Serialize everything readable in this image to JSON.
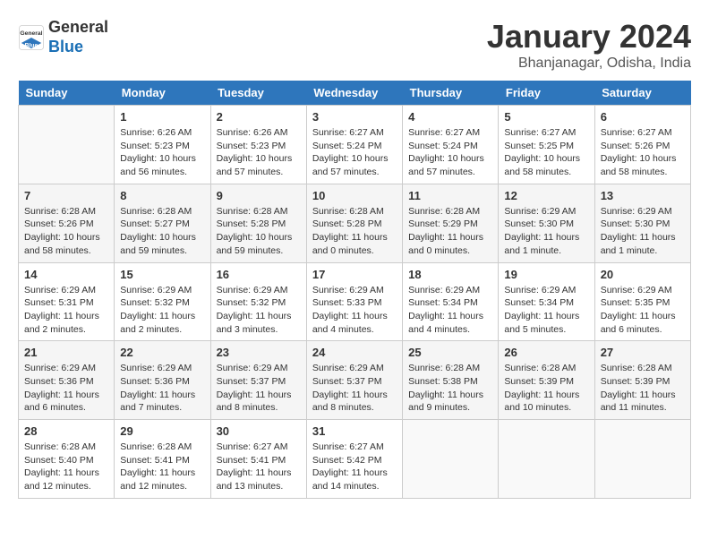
{
  "header": {
    "logo_line1": "General",
    "logo_line2": "Blue",
    "month_title": "January 2024",
    "location": "Bhanjanagar, Odisha, India"
  },
  "days_of_week": [
    "Sunday",
    "Monday",
    "Tuesday",
    "Wednesday",
    "Thursday",
    "Friday",
    "Saturday"
  ],
  "weeks": [
    [
      {
        "day": "",
        "info": ""
      },
      {
        "day": "1",
        "info": "Sunrise: 6:26 AM\nSunset: 5:23 PM\nDaylight: 10 hours\nand 56 minutes."
      },
      {
        "day": "2",
        "info": "Sunrise: 6:26 AM\nSunset: 5:23 PM\nDaylight: 10 hours\nand 57 minutes."
      },
      {
        "day": "3",
        "info": "Sunrise: 6:27 AM\nSunset: 5:24 PM\nDaylight: 10 hours\nand 57 minutes."
      },
      {
        "day": "4",
        "info": "Sunrise: 6:27 AM\nSunset: 5:24 PM\nDaylight: 10 hours\nand 57 minutes."
      },
      {
        "day": "5",
        "info": "Sunrise: 6:27 AM\nSunset: 5:25 PM\nDaylight: 10 hours\nand 58 minutes."
      },
      {
        "day": "6",
        "info": "Sunrise: 6:27 AM\nSunset: 5:26 PM\nDaylight: 10 hours\nand 58 minutes."
      }
    ],
    [
      {
        "day": "7",
        "info": "Sunrise: 6:28 AM\nSunset: 5:26 PM\nDaylight: 10 hours\nand 58 minutes."
      },
      {
        "day": "8",
        "info": "Sunrise: 6:28 AM\nSunset: 5:27 PM\nDaylight: 10 hours\nand 59 minutes."
      },
      {
        "day": "9",
        "info": "Sunrise: 6:28 AM\nSunset: 5:28 PM\nDaylight: 10 hours\nand 59 minutes."
      },
      {
        "day": "10",
        "info": "Sunrise: 6:28 AM\nSunset: 5:28 PM\nDaylight: 11 hours\nand 0 minutes."
      },
      {
        "day": "11",
        "info": "Sunrise: 6:28 AM\nSunset: 5:29 PM\nDaylight: 11 hours\nand 0 minutes."
      },
      {
        "day": "12",
        "info": "Sunrise: 6:29 AM\nSunset: 5:30 PM\nDaylight: 11 hours\nand 1 minute."
      },
      {
        "day": "13",
        "info": "Sunrise: 6:29 AM\nSunset: 5:30 PM\nDaylight: 11 hours\nand 1 minute."
      }
    ],
    [
      {
        "day": "14",
        "info": "Sunrise: 6:29 AM\nSunset: 5:31 PM\nDaylight: 11 hours\nand 2 minutes."
      },
      {
        "day": "15",
        "info": "Sunrise: 6:29 AM\nSunset: 5:32 PM\nDaylight: 11 hours\nand 2 minutes."
      },
      {
        "day": "16",
        "info": "Sunrise: 6:29 AM\nSunset: 5:32 PM\nDaylight: 11 hours\nand 3 minutes."
      },
      {
        "day": "17",
        "info": "Sunrise: 6:29 AM\nSunset: 5:33 PM\nDaylight: 11 hours\nand 4 minutes."
      },
      {
        "day": "18",
        "info": "Sunrise: 6:29 AM\nSunset: 5:34 PM\nDaylight: 11 hours\nand 4 minutes."
      },
      {
        "day": "19",
        "info": "Sunrise: 6:29 AM\nSunset: 5:34 PM\nDaylight: 11 hours\nand 5 minutes."
      },
      {
        "day": "20",
        "info": "Sunrise: 6:29 AM\nSunset: 5:35 PM\nDaylight: 11 hours\nand 6 minutes."
      }
    ],
    [
      {
        "day": "21",
        "info": "Sunrise: 6:29 AM\nSunset: 5:36 PM\nDaylight: 11 hours\nand 6 minutes."
      },
      {
        "day": "22",
        "info": "Sunrise: 6:29 AM\nSunset: 5:36 PM\nDaylight: 11 hours\nand 7 minutes."
      },
      {
        "day": "23",
        "info": "Sunrise: 6:29 AM\nSunset: 5:37 PM\nDaylight: 11 hours\nand 8 minutes."
      },
      {
        "day": "24",
        "info": "Sunrise: 6:29 AM\nSunset: 5:37 PM\nDaylight: 11 hours\nand 8 minutes."
      },
      {
        "day": "25",
        "info": "Sunrise: 6:28 AM\nSunset: 5:38 PM\nDaylight: 11 hours\nand 9 minutes."
      },
      {
        "day": "26",
        "info": "Sunrise: 6:28 AM\nSunset: 5:39 PM\nDaylight: 11 hours\nand 10 minutes."
      },
      {
        "day": "27",
        "info": "Sunrise: 6:28 AM\nSunset: 5:39 PM\nDaylight: 11 hours\nand 11 minutes."
      }
    ],
    [
      {
        "day": "28",
        "info": "Sunrise: 6:28 AM\nSunset: 5:40 PM\nDaylight: 11 hours\nand 12 minutes."
      },
      {
        "day": "29",
        "info": "Sunrise: 6:28 AM\nSunset: 5:41 PM\nDaylight: 11 hours\nand 12 minutes."
      },
      {
        "day": "30",
        "info": "Sunrise: 6:27 AM\nSunset: 5:41 PM\nDaylight: 11 hours\nand 13 minutes."
      },
      {
        "day": "31",
        "info": "Sunrise: 6:27 AM\nSunset: 5:42 PM\nDaylight: 11 hours\nand 14 minutes."
      },
      {
        "day": "",
        "info": ""
      },
      {
        "day": "",
        "info": ""
      },
      {
        "day": "",
        "info": ""
      }
    ]
  ]
}
